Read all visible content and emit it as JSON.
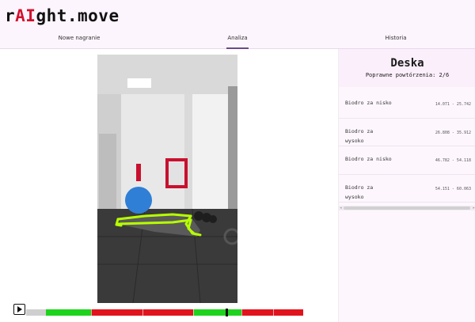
{
  "app": {
    "logo_prefix": "r",
    "logo_ai": "AI",
    "logo_suffix": "ght.move"
  },
  "tabs": [
    {
      "label": "Nowe nagranie",
      "active": false
    },
    {
      "label": "Analiza",
      "active": true
    },
    {
      "label": "Historia",
      "active": false
    }
  ],
  "analysis": {
    "exercise": "Deska",
    "reps_label": "Poprawne powtórzenia: 2/6",
    "errors": [
      {
        "label": "Biodro za nisko",
        "range": "14.071 - 25.742"
      },
      {
        "label": "Biodro za wysoko",
        "range": "26.808 - 35.912"
      },
      {
        "label": "Biodro za nisko",
        "range": "46.782 - 54.118"
      },
      {
        "label": "Biodro za wysoko",
        "range": "54.151 - 60.063"
      }
    ]
  },
  "timeline": {
    "colors": {
      "neutral": "#cfcfcf",
      "good": "#1ed31e",
      "bad": "#e1141e"
    },
    "segments": [
      {
        "status": "neutral",
        "start": 0.0,
        "end": 0.07
      },
      {
        "status": "good",
        "start": 0.07,
        "end": 0.235
      },
      {
        "status": "bad",
        "start": 0.235,
        "end": 0.602
      },
      {
        "status": "good",
        "start": 0.602,
        "end": 0.777
      },
      {
        "status": "bad",
        "start": 0.777,
        "end": 1.0
      }
    ],
    "position": 0.72
  }
}
